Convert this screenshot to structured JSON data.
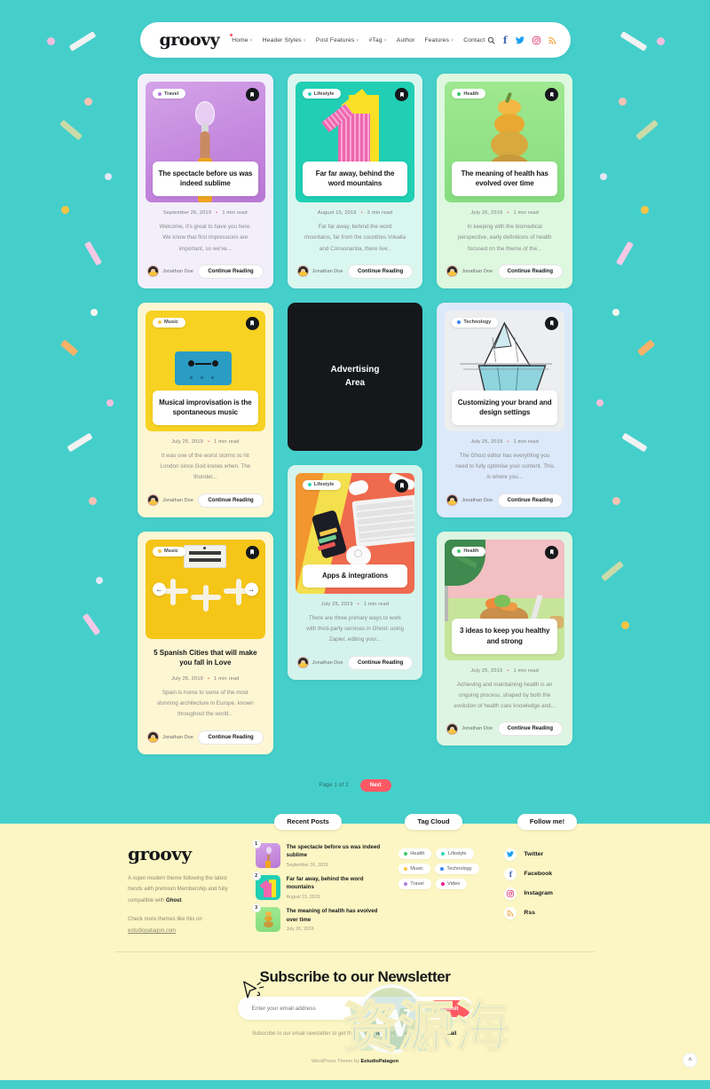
{
  "site": {
    "brand": "groovy",
    "background_color": "#45cfcb",
    "accent_color": "#ff5964",
    "footer_bg": "#fcf6c4"
  },
  "header": {
    "nav": [
      {
        "label": "Home",
        "caret": "˅",
        "dot": true
      },
      {
        "label": "Header Styles",
        "caret": "˅",
        "dot": false
      },
      {
        "label": "Post Features",
        "caret": "˅",
        "dot": false
      },
      {
        "label": "#Tag",
        "caret": "˅",
        "dot": false
      },
      {
        "label": "Author",
        "caret": "",
        "dot": false
      },
      {
        "label": "Features",
        "caret": "˅",
        "dot": false
      },
      {
        "label": "Contact",
        "caret": "",
        "dot": false
      }
    ],
    "search_icon": "⌕",
    "social": [
      {
        "name": "facebook-icon",
        "glyph": "f"
      },
      {
        "name": "twitter-icon",
        "glyph": "➤"
      },
      {
        "name": "instagram-icon",
        "glyph": "▢"
      },
      {
        "name": "rss-icon",
        "glyph": "⌇"
      }
    ]
  },
  "posts": {
    "p1": {
      "tag": "Travel",
      "tag_color": "#b07be0",
      "title": "The spectacle before us was indeed sublime",
      "date": "September 26, 2019",
      "read": "1 min read",
      "excerpt": "Welcome, it's great to have you here. We know that first impressions are important, so we've...",
      "author": "Jonathan Doe",
      "cta": "Continue Reading"
    },
    "p2": {
      "tag": "Lifestyle",
      "tag_color": "#2fd8b8",
      "title": "Far far away, behind the word mountains",
      "date": "August 15, 2019",
      "read": "2 min read",
      "excerpt": "Far far away, behind the word mountains, far from the countries Vokalia and Consonantia, there live..",
      "author": "Jonathan Doe",
      "cta": "Continue Reading"
    },
    "p3": {
      "tag": "Health",
      "tag_color": "#3ec96b",
      "title": "The meaning of health has evolved over time",
      "date": "July 26, 2019",
      "read": "1 min read",
      "excerpt": "In keeping with the biomedical perspective, early definitions of health focused on the theme of the...",
      "author": "Jonathan Doe",
      "cta": "Continue Reading"
    },
    "p4": {
      "tag": "Music",
      "tag_color": "#f6c445",
      "title": "Musical improvisation is the spontaneous music",
      "date": "July 25, 2019",
      "read": "1 min read",
      "excerpt": "It was one of the worst storms to hit London since God knows when. The thunder...",
      "author": "Jonathan Doe",
      "cta": "Continue Reading"
    },
    "p5": {
      "tag": "Technology",
      "tag_color": "#3b82f6",
      "title": "Customizing your brand and design settings",
      "date": "July 25, 2019",
      "read": "1 min read",
      "excerpt": "The Ghost editor has everything you need to fully optimise your content. This is where you...",
      "author": "Jonathan Doe",
      "cta": "Continue Reading"
    },
    "p6": {
      "tag": "Music",
      "tag_color": "#f6c445",
      "title": "5 Spanish Cities that will make you fall in Love",
      "date": "July 25, 2019",
      "read": "1 min read",
      "excerpt": "Spain is home to some of the most stunning architecture in Europe, known throughout the world...",
      "author": "Jonathan Doe",
      "cta": "Continue Reading",
      "prev_icon": "←",
      "next_icon": "→"
    },
    "p7": {
      "tag": "Lifestyle",
      "tag_color": "#2fd8b8",
      "title": "Apps & integrations",
      "date": "July 25, 2019",
      "read": "1 min read",
      "excerpt": "There are three primary ways to work with third-party services in Ghost: using Zapier, editing your...",
      "author": "Jonathan Doe",
      "cta": "Continue Reading"
    },
    "p8": {
      "tag": "Health",
      "tag_color": "#3ec96b",
      "title": "3 ideas to keep you healthy and strong",
      "date": "July 25, 2019",
      "read": "1 min read",
      "excerpt": "Achieving and maintaining health is an ongoing process, shaped by both the evolution of health care knowledge and...",
      "author": "Jonathan Doe",
      "cta": "Continue Reading"
    }
  },
  "ad": {
    "line1": "Advertising",
    "line2": "Area"
  },
  "pagination": {
    "page_text": "Page 1 of 2",
    "next_label": "Next"
  },
  "footer": {
    "about": {
      "brand": "groovy",
      "p1_a": "A super modern theme following the latest trends with premium Membership and fully compatible with ",
      "p1_b": "Ghost",
      "p1_c": ".",
      "p2_a": "Check more themes like this on ",
      "p2_b": "estudiopatagon.com"
    },
    "recent_posts": {
      "title": "Recent Posts",
      "items": [
        {
          "num": "1",
          "title": "The spectacle before us was indeed sublime",
          "date": "September 26, 2019"
        },
        {
          "num": "2",
          "title": "Far far away, behind the word mountains",
          "date": "August 15, 2019"
        },
        {
          "num": "3",
          "title": "The meaning of health has evolved over time",
          "date": "July 26, 2019"
        }
      ]
    },
    "tag_cloud": {
      "title": "Tag Cloud",
      "tags": [
        {
          "label": "Health",
          "color": "#3ec96b"
        },
        {
          "label": "Lifestyle",
          "color": "#2fd8b8"
        },
        {
          "label": "Music",
          "color": "#f6c445"
        },
        {
          "label": "Technology",
          "color": "#3b82f6"
        },
        {
          "label": "Travel",
          "color": "#b07be0"
        },
        {
          "label": "Video",
          "color": "#e91e8c"
        }
      ]
    },
    "follow": {
      "title": "Follow me!",
      "items": [
        {
          "label": "Twitter",
          "icon": "twitter-icon",
          "glyph": "➤",
          "color": "#1DA1F2"
        },
        {
          "label": "Facebook",
          "icon": "facebook-icon",
          "glyph": "f",
          "color": "#4267B2"
        },
        {
          "label": "Instagram",
          "icon": "instagram-icon",
          "glyph": "▢",
          "color": "#E1306C"
        },
        {
          "label": "Rss",
          "icon": "rss-icon",
          "glyph": "⌇",
          "color": "#f2a33c"
        }
      ]
    },
    "newsletter": {
      "title": "Subscribe to our Newsletter",
      "placeholder": "Enter your email address",
      "submit": "Submit",
      "note_a": "Subscribe to our email newsletter to get the ",
      "note_b": "latest posts",
      "note_c": " delivered ",
      "note_d": "right to your email",
      "note_e": "."
    },
    "credit_a": "WordPress Theme by ",
    "credit_b": "EstudioPatagon"
  },
  "watermark": {
    "wp": "WP",
    "cn": "资源海"
  },
  "to_top": {
    "icon": "˄"
  }
}
